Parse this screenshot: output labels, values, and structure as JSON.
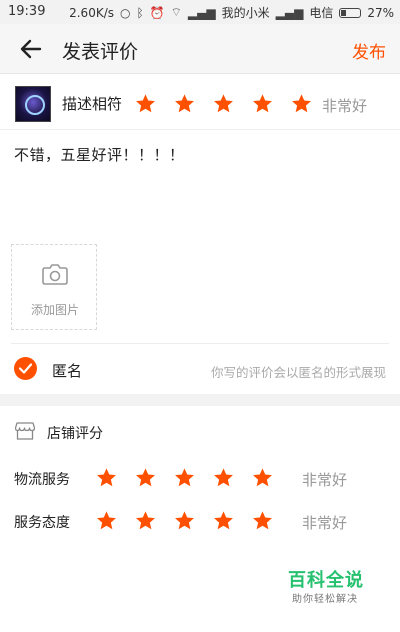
{
  "status_bar": {
    "time": "19:39",
    "speed": "2.60K/s",
    "carrier1": "我的小米",
    "carrier2": "电信",
    "battery": "27%"
  },
  "header": {
    "title": "发表评价",
    "publish": "发布"
  },
  "product": {
    "desc_label": "描述相符",
    "rating_text": "非常好",
    "stars": 5
  },
  "review": {
    "text": "不错，五星好评！！！！"
  },
  "photo": {
    "label": "添加图片"
  },
  "anonymous": {
    "label": "匿名",
    "note": "你写的评价会以匿名的形式展现",
    "checked": true
  },
  "shop_rating": {
    "title": "店铺评分",
    "rows": [
      {
        "label": "物流服务",
        "rating_text": "非常好",
        "stars": 5
      },
      {
        "label": "服务态度",
        "rating_text": "非常好",
        "stars": 5
      }
    ]
  },
  "watermark": {
    "main": "百科全说",
    "sub": "助你轻松解决"
  },
  "colors": {
    "accent": "#ff5000",
    "watermark": "#25c16f"
  }
}
